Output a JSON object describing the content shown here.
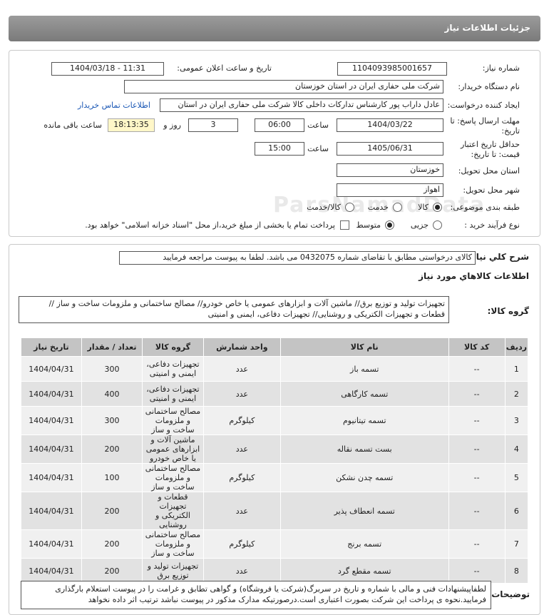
{
  "header": {
    "title": "جزئیات اطلاعات نیاز"
  },
  "form": {
    "need_number_label": "شماره نیاز:",
    "need_number": "1104093985001657",
    "announce_label": "تاریخ و ساعت اعلان عمومی:",
    "announce_value": "1404/03/18 - 11:31",
    "buyer_label": "نام دستگاه خریدار:",
    "buyer_value": "شرکت ملی حفاری ایران در استان خوزستان",
    "creator_label": "ایجاد کننده درخواست:",
    "creator_value": "عادل داراب پور کارشناس تدارکات داخلی کالا شرکت ملی حفاری ایران در استان",
    "contact_link": "اطلاعات تماس خریدار",
    "deadline_label": "مهلت ارسال پاسخ: تا تاریخ:",
    "deadline_date": "1404/03/22",
    "time_label": "ساعت",
    "deadline_time": "06:00",
    "days_value": "3",
    "days_label": "روز و",
    "remaining_time": "18:13:35",
    "remaining_label": "ساعت باقی مانده",
    "validity_label": "حداقل تاریخ اعتبار قیمت: تا تاریخ:",
    "validity_date": "1405/06/31",
    "validity_time": "15:00",
    "province_label": "استان محل تحویل:",
    "province_value": "خوزستان",
    "city_label": "شهر محل تحویل:",
    "city_value": "اهواز",
    "category_label": "طبقه بندی موضوعی:",
    "category_options": [
      "کالا",
      "خدمت",
      "کالا/خدمت"
    ],
    "category_selected": "کالا",
    "purchase_label": "نوع فرآیند خرید :",
    "purchase_options": [
      "جزیی",
      "متوسط"
    ],
    "purchase_selected": "متوسط",
    "payment_text": "پرداخت تمام یا بخشی از مبلغ خرید،از محل \"اسناد خزانه اسلامی\" خواهد بود."
  },
  "description": {
    "label": "شرح کلي نياز:",
    "value": "کالای درخواستی مطابق با تقاضای شماره 0432075 می باشد. لطفا به پیوست مراجعه فرمایید"
  },
  "goods": {
    "section_title": "اطلاعات کالاهاي مورد نياز",
    "group_label": "گروه کالا:",
    "group_value": "تجهیزات تولید و توزیع برق// ماشین آلات و ابزارهای عمومی یا خاص خودرو// مصالح ساختمانی و ملزومات ساخت و ساز // قطعات و تجهیزات الکتریکی و روشنایی// تجهیزات دفاعی، ایمنی و امنیتی",
    "columns": [
      "ردیف",
      "کد کالا",
      "نام کالا",
      "واحد شمارش",
      "گروه کالا",
      "تعداد / مقدار",
      "تاریخ نیاز"
    ],
    "rows": [
      [
        "1",
        "--",
        "تسمه باز",
        "عدد",
        "تجهیزات دفاعی، ایمنی و امنیتی",
        "300",
        "1404/04/31"
      ],
      [
        "2",
        "--",
        "تسمه کارگاهی",
        "عدد",
        "تجهیزات دفاعی، ایمنی و امنیتی",
        "400",
        "1404/04/31"
      ],
      [
        "3",
        "--",
        "تسمه تیتانیوم",
        "کیلوگرم",
        "مصالح ساختمانی و ملزومات ساخت و ساز",
        "300",
        "1404/04/31"
      ],
      [
        "4",
        "--",
        "بست تسمه نقاله",
        "عدد",
        "ماشین آلات و ابزارهای عمومی یا خاص خودرو",
        "200",
        "1404/04/31"
      ],
      [
        "5",
        "--",
        "تسمه چدن نشکن",
        "کیلوگرم",
        "مصالح ساختمانی و ملزومات ساخت و ساز",
        "100",
        "1404/04/31"
      ],
      [
        "6",
        "--",
        "تسمه انعطاف پذیر",
        "عدد",
        "قطعات و تجهیزات الکتریکی و روشنایی",
        "200",
        "1404/04/31"
      ],
      [
        "7",
        "--",
        "تسمه برنج",
        "کیلوگرم",
        "مصالح ساختمانی و ملزومات ساخت و ساز",
        "200",
        "1404/04/31"
      ],
      [
        "8",
        "--",
        "تسمه مقطع گرد",
        "عدد",
        "تجهیزات تولید و توزیع برق",
        "200",
        "1404/04/31"
      ]
    ]
  },
  "notes": {
    "label": "توضیحات",
    "value": "لطفاپیشنهادات فنی و مالی با شماره و تاریخ در سربرگ(شرکت یا فروشگاه) و گواهی تطابق و غرامت را در پیوست استعلام بارگذاری فرمایید.نحوه ی پرداخت این شرکت بصورت اعتباری است.درصورتیکه مدارک مذکور در پیوست نباشد ترتیب اثر داده نخواهد"
  },
  "watermark": {
    "brand": "ParsNamadData",
    "line1": "مرکز فراوری اطلاعات پارس نماد داده",
    "line2": "پایگاه اطلاع رسانی مناقصه و مزایده",
    "phone": "۰۲۱-۸۸۳۴۹۶۷۰-۵"
  }
}
